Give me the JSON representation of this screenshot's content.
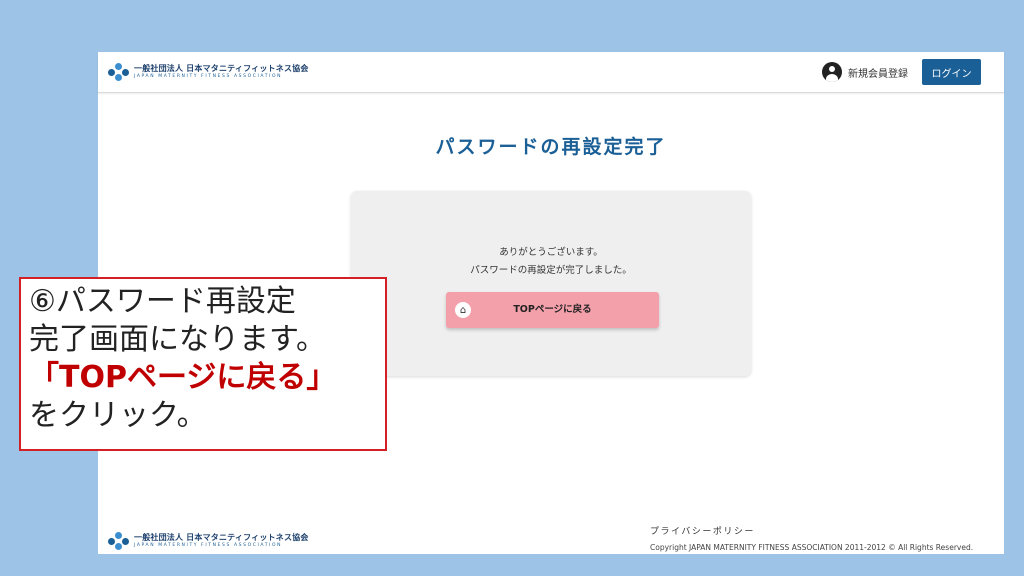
{
  "header": {
    "logo_ja": "一般社団法人 日本マタニティフィットネス協会",
    "logo_en": "JAPAN MATERNITY FITNESS ASSOCIATION",
    "register_label": "新規会員登録",
    "login_label": "ログイン"
  },
  "main": {
    "title": "パスワードの再設定完了",
    "message_line1": "ありがとうございます。",
    "message_line2": "パスワードの再設定が完了しました。",
    "top_button_label": "TOPページに戻る",
    "top_button_icon": "home-icon"
  },
  "footer": {
    "privacy_label": "プライバシーポリシー",
    "copyright": "Copyright JAPAN MATERNITY FITNESS ASSOCIATION 2011-2012 © All Rights Reserved."
  },
  "callout": {
    "line1": "⑥パスワード再設定",
    "line2": "完了画面になります。",
    "line3": "「TOPページに戻る」",
    "line4": "をクリック。"
  },
  "colors": {
    "brand": "#1b5f97",
    "button_pink": "#f4a0ab",
    "callout_border": "#d32026",
    "callout_highlight": "#c00000",
    "slide_background": "#9dc3e6"
  }
}
